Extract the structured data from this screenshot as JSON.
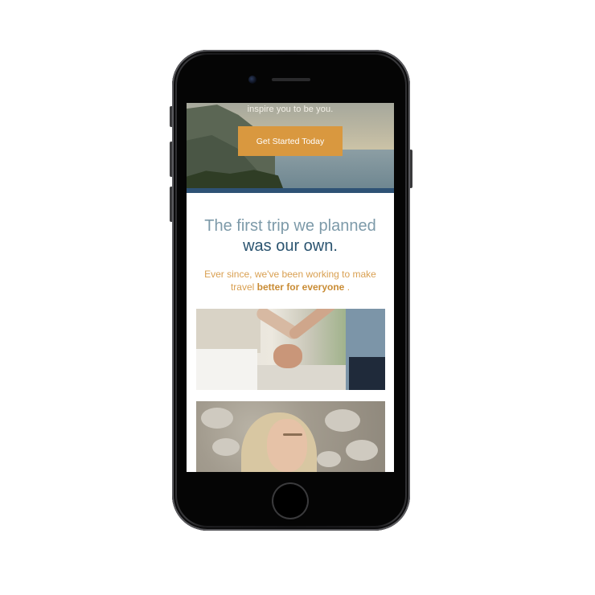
{
  "hero": {
    "tagline": "inspire you to be you.",
    "cta_label": "Get Started Today"
  },
  "intro": {
    "title_line1": "The first trip we planned",
    "title_line2": "was our own.",
    "subtitle_line1": "Ever since, we've been working to make",
    "subtitle_line2_prefix": "travel",
    "subtitle_highlight": "better for everyone",
    "subtitle_suffix": "."
  },
  "colors": {
    "accent_orange": "#d9983f",
    "divider_blue": "#2e5275",
    "title_blue": "#2b5470",
    "title_light_blue": "#7d9aa9"
  },
  "images": {
    "photo1": "couple-holding-hands",
    "photo2": "woman-on-rocks"
  }
}
